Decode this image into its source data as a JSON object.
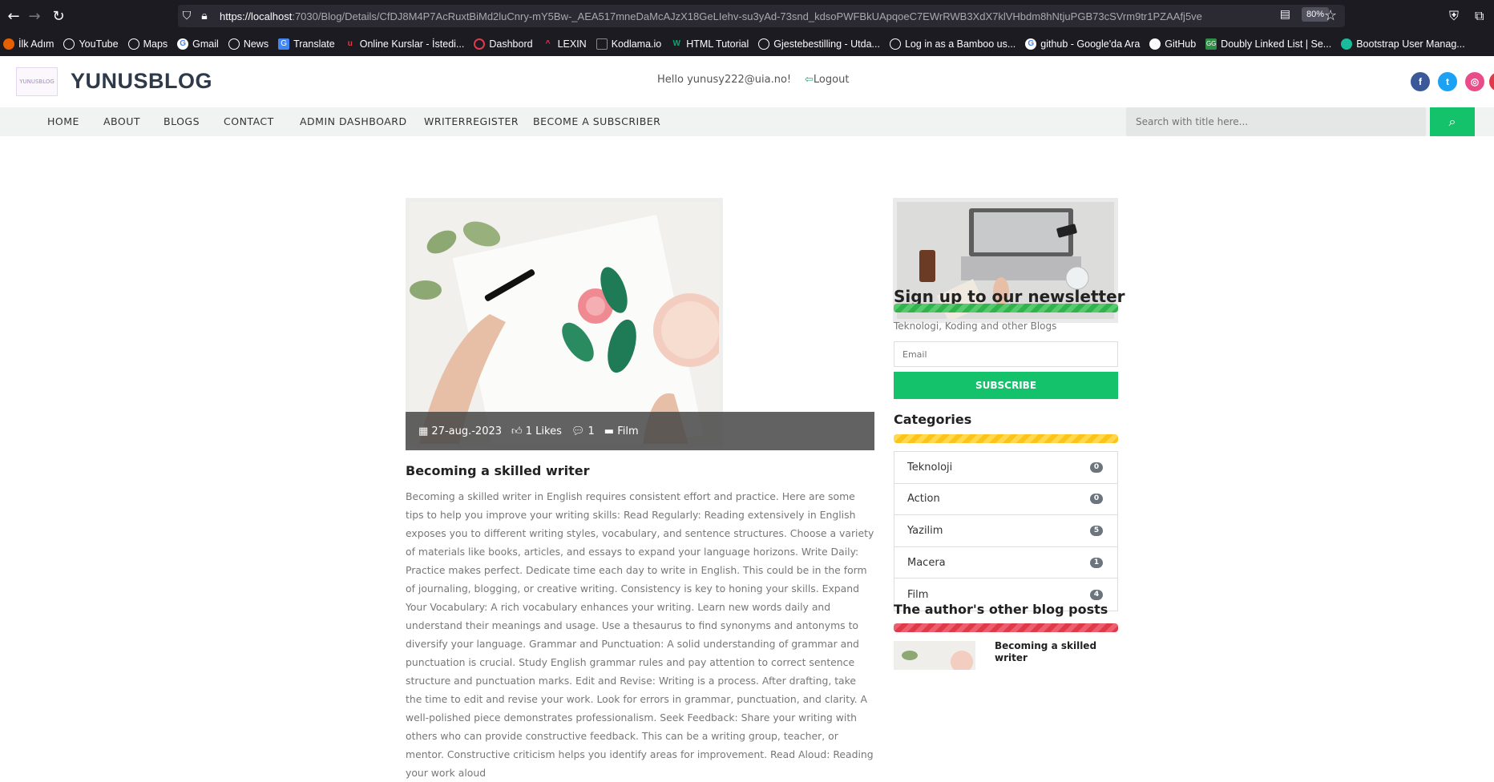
{
  "browser": {
    "url_host": "https://localhost",
    "url_path": ":7030/Blog/Details/CfDJ8M4P7AcRuxtBiMd2luCnry-mY5Bw-_AEA517mneDaMcAJzX18GeLIehv-su3yAd-73snd_kdsoPWFBkUApqoeC7EWrRWB3XdX7klVHbdm8hNtjuPGB73cSVrm9tr1PZAAfj5ve",
    "zoom": "80%",
    "bookmarks": [
      "İlk Adım",
      "YouTube",
      "Maps",
      "Gmail",
      "News",
      "Translate",
      "Online Kurslar - İstedi...",
      "Dashbord",
      "LEXIN",
      "Kodlama.io",
      "HTML Tutorial",
      "Gjestebestilling - Utda...",
      "Log in as a Bamboo us...",
      "github - Google'da Ara",
      "GitHub",
      "Doubly Linked List | Se...",
      "Bootstrap User Manag..."
    ]
  },
  "header": {
    "logo_text": "YUNUSBLOG",
    "brand": "YUNUSBLOG",
    "greeting": "Hello yunusy222@uia.no!",
    "logout": "Logout"
  },
  "nav": {
    "items": [
      "HOME",
      "ABOUT",
      "BLOGS",
      "CONTACT",
      "ADMIN DASHBOARD",
      "WRITERREGISTER",
      "BECOME A SUBSCRIBER"
    ],
    "search_placeholder": "Search with title here..."
  },
  "post": {
    "date": "27-aug.-2023",
    "likes": "1 Likes",
    "comments": "1",
    "category": "Film",
    "title": "Becoming a skilled writer",
    "body": "Becoming a skilled writer in English requires consistent effort and practice. Here are some tips to help you improve your writing skills:  Read Regularly: Reading extensively in English exposes you to different writing styles, vocabulary, and sentence structures. Choose a variety of materials like books, articles, and essays to expand your language horizons.  Write Daily: Practice makes perfect. Dedicate time each day to write in English. This could be in the form of journaling, blogging, or creative writing. Consistency is key to honing your skills.  Expand Your Vocabulary: A rich vocabulary enhances your writing. Learn new words daily and understand their meanings and usage. Use a thesaurus to find synonyms and antonyms to diversify your language.  Grammar and Punctuation: A solid understanding of grammar and punctuation is crucial. Study English grammar rules and pay attention to correct sentence structure and punctuation marks.  Edit and Revise: Writing is a process. After drafting, take the time to edit and revise your work. Look for errors in grammar, punctuation, and clarity. A well-polished piece demonstrates professionalism.  Seek Feedback: Share your writing with others who can provide constructive feedback. This can be a writing group, teacher, or mentor. Constructive criticism helps you identify areas for improvement.  Read Aloud: Reading your work aloud"
  },
  "sidebar": {
    "newsletter_title": "Sign up to our newsletter",
    "newsletter_desc": "Teknologi, Koding and other Blogs",
    "email_placeholder": "Email",
    "subscribe_label": "SUBSCRIBE",
    "categories_title": "Categories",
    "categories": [
      {
        "name": "Teknoloji",
        "count": "0"
      },
      {
        "name": "Action",
        "count": "0"
      },
      {
        "name": "Yazilim",
        "count": "5"
      },
      {
        "name": "Macera",
        "count": "1"
      },
      {
        "name": "Film",
        "count": "4"
      }
    ],
    "other_posts_title": "The author's other blog posts",
    "other_post_title": "Becoming a skilled writer"
  },
  "colors": {
    "accent_green": "#13c26b",
    "stripe_green": "#2fb34b",
    "stripe_yellow": "#fcc419",
    "stripe_red": "#e03a4a"
  }
}
